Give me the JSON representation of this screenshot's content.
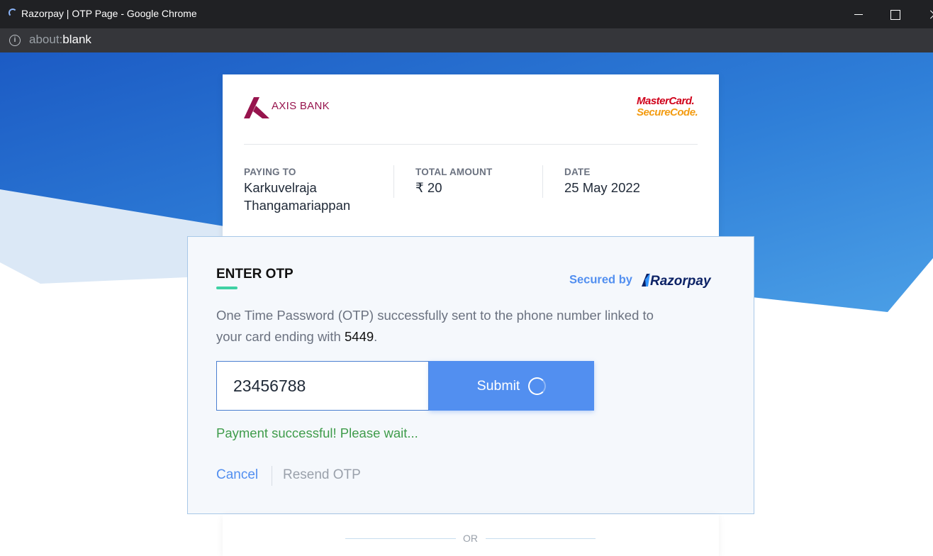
{
  "browser": {
    "window_title": "Razorpay | OTP Page - Google Chrome",
    "url_scheme": "about:",
    "url_host": "blank"
  },
  "merchant_card": {
    "bank_name": "AXIS BANK",
    "network_logo": {
      "line1": "MasterCard.",
      "line2": "SecureCode."
    },
    "paying_to": {
      "label": "PAYING TO",
      "value_line1": "Karkuvelraja",
      "value_line2": "Thangamariappan"
    },
    "total_amount": {
      "label": "TOTAL AMOUNT",
      "value": "₹ 20"
    },
    "date": {
      "label": "DATE",
      "value": "25 May 2022"
    }
  },
  "otp": {
    "heading": "ENTER OTP",
    "secured_by": "Secured by",
    "provider": "Razorpay",
    "description_line1": "One Time Password (OTP) successfully sent to the phone number linked to",
    "description_line2_prefix": "your card ending with ",
    "card_last4": "5449",
    "description_line2_suffix": ".",
    "input_value": "23456788",
    "submit_label": "Submit",
    "status_message": "Payment successful! Please wait...",
    "cancel_label": "Cancel",
    "resend_label": "Resend OTP"
  },
  "footer": {
    "or_text": "OR"
  },
  "colors": {
    "brand_blue": "#528ff0",
    "bank_maroon": "#97144d",
    "success_green": "#3f9c4b",
    "accent_teal": "#3fd1a4"
  }
}
